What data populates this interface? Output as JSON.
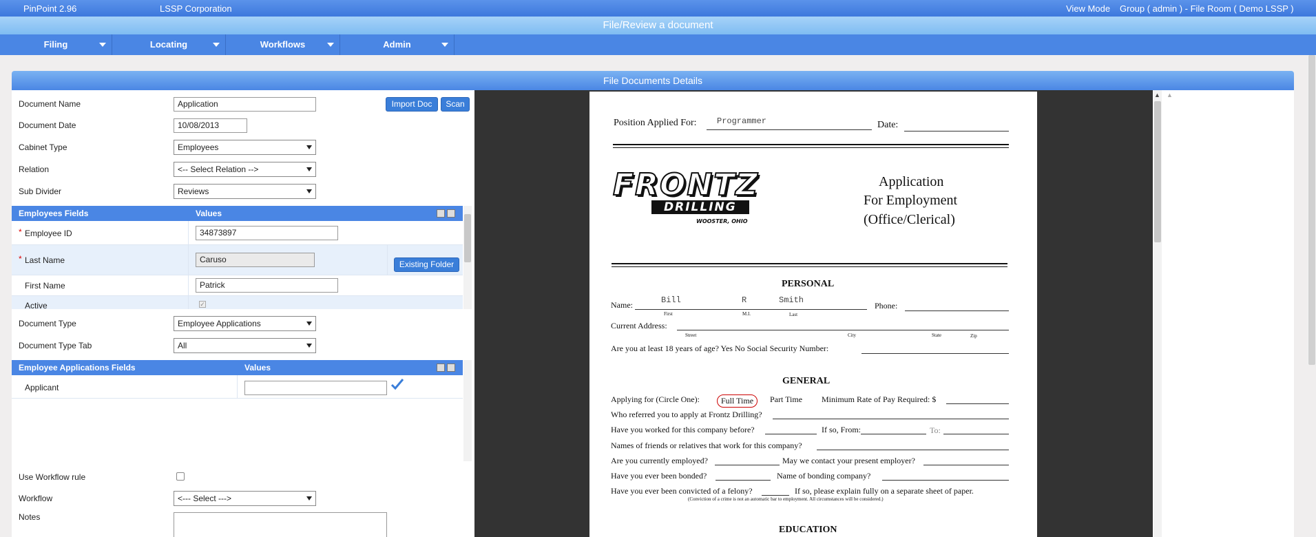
{
  "topbar": {
    "app": "PinPoint 2.96",
    "company": "LSSP Corporation",
    "mode": "View Mode",
    "context": "Group ( admin ) - File Room ( Demo LSSP )"
  },
  "title": "File/Review a document",
  "menu": [
    "Filing",
    "Locating",
    "Workflows",
    "Admin"
  ],
  "panel_title": "File Documents Details",
  "form": {
    "document_name_label": "Document Name",
    "document_name_value": "Application",
    "document_date_label": "Document Date",
    "document_date_value": "10/08/2013",
    "cabinet_type_label": "Cabinet Type",
    "cabinet_type_value": "Employees",
    "relation_label": "Relation",
    "relation_value": "<-- Select Relation -->",
    "sub_divider_label": "Sub Divider",
    "sub_divider_value": "Reviews",
    "import_doc": "Import Doc",
    "scan": "Scan",
    "document_type_label": "Document Type",
    "document_type_value": "Employee Applications",
    "document_type_tab_label": "Document Type Tab",
    "document_type_tab_value": "All",
    "use_workflow_label": "Use Workflow rule",
    "workflow_label": "Workflow",
    "workflow_value": "<--- Select --->",
    "notes_label": "Notes"
  },
  "employees_grid": {
    "col1": "Employees Fields",
    "col2": "Values",
    "rows": [
      {
        "label": "Employee ID",
        "value": "34873897",
        "required": "*"
      },
      {
        "label": "Last Name",
        "value": "Caruso",
        "required": "*"
      },
      {
        "label": "First Name",
        "value": "Patrick"
      },
      {
        "label": "Active",
        "value": ""
      }
    ],
    "existing_folder": "Existing Folder"
  },
  "applications_grid": {
    "col1": "Employee Applications Fields",
    "col2": "Values",
    "rows": [
      {
        "label": "Applicant",
        "value": ""
      }
    ]
  },
  "doc": {
    "position_applied": "Position Applied For:",
    "position_value": "Programmer",
    "date_label": "Date:",
    "logo_line1": "FRONTZ",
    "logo_line2": "DRILLING",
    "logo_line3": "WOOSTER, OHIO",
    "heading1": "Application",
    "heading2": "For Employment",
    "heading3": "(Office/Clerical)",
    "personal": "PERSONAL",
    "name_label": "Name:",
    "first": "Bill",
    "mi": "R",
    "last": "Smith",
    "sub_first": "First",
    "sub_mi": "M.I.",
    "sub_last": "Last",
    "phone_label": "Phone:",
    "address_label": "Current Address:",
    "sub_street": "Street",
    "sub_city": "City",
    "sub_state": "State",
    "sub_zip": "Zip",
    "age_q": "Are you at least 18 years of age?  Yes  No   Social Security Number:",
    "general": "GENERAL",
    "applying_for": "Applying for (Circle One):",
    "full_time": "Full Time",
    "part_time": "Part Time",
    "min_rate": "Minimum Rate of Pay Required: $",
    "referred": "Who referred you to apply at Frontz Drilling?",
    "worked_before": "Have you worked for this company before?",
    "if_so_from": "If so, From:",
    "to": "To:",
    "friends": "Names of friends or relatives that work for this company?",
    "employed": "Are you currently employed?",
    "contact": "May we contact your present employer?",
    "bonded": "Have you ever been bonded?",
    "bonding": "Name of bonding company?",
    "felony": "Have you ever been convicted of a felony?",
    "felony_explain": "If so, please explain fully on a separate sheet of paper.",
    "felony_note": "(Conviction of a crime is not an automatic bar to employment.  All circumstances will be considered.)",
    "education": "EDUCATION"
  }
}
